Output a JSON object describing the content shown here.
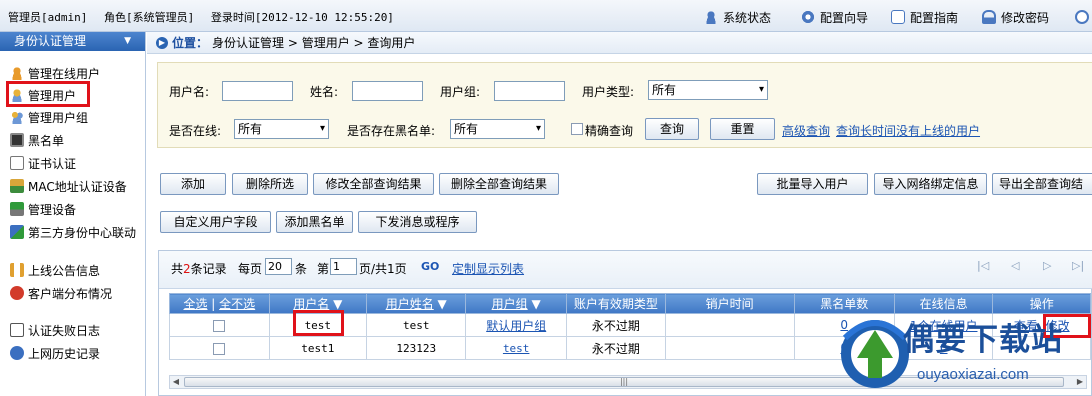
{
  "topbar": {
    "admin_text": "管理员[admin]",
    "role_text": "角色[系统管理员]",
    "login_text": "登录时间[2012-12-10 12:55:20]",
    "links": [
      {
        "label": "系统状态",
        "icon": "user-icon"
      },
      {
        "label": "配置向导",
        "icon": "gear-icon"
      },
      {
        "label": "配置指南",
        "icon": "document-icon"
      },
      {
        "label": "修改密码",
        "icon": "lock-icon"
      }
    ]
  },
  "sidebar": {
    "header": "身份认证管理",
    "items": [
      {
        "label": "管理在线用户",
        "icon": "user-online-icon"
      },
      {
        "label": "管理用户",
        "icon": "user-icon"
      },
      {
        "label": "管理用户组",
        "icon": "group-icon"
      },
      {
        "label": "黑名单",
        "icon": "blacklist-icon"
      },
      {
        "label": "证书认证",
        "icon": "certificate-icon"
      },
      {
        "label": "MAC地址认证设备",
        "icon": "mac-icon"
      },
      {
        "label": "管理设备",
        "icon": "device-icon"
      },
      {
        "label": "第三方身份中心联动",
        "icon": "link-icon"
      },
      {
        "label": "上线公告信息",
        "icon": "speaker-icon"
      },
      {
        "label": "客户端分布情况",
        "icon": "chart-icon"
      },
      {
        "label": "认证失败日志",
        "icon": "log-icon"
      },
      {
        "label": "上网历史记录",
        "icon": "history-icon"
      }
    ]
  },
  "breadcrumb": {
    "location_label": "位置：",
    "path": "身份认证管理 > 管理用户 > 查询用户"
  },
  "search": {
    "username_label": "用户名:",
    "name_label": "姓名:",
    "group_label": "用户组:",
    "type_label": "用户类型:",
    "type_value": "所有",
    "online_label": "是否在线:",
    "online_value": "所有",
    "blacklist_label": "是否存在黑名单:",
    "blacklist_value": "所有",
    "exact_label": "精确查询",
    "query_button": "查询",
    "reset_button": "重置",
    "advanced_link": "高级查询",
    "inactive_link": "查询长时间没有上线的用户"
  },
  "actions": {
    "add": "添加",
    "delete_selected": "删除所选",
    "modify_all": "修改全部查询结果",
    "delete_all": "删除全部查询结果",
    "batch_import": "批量导入用户",
    "import_binding": "导入网络绑定信息",
    "export_all": "导出全部查询结",
    "custom_field": "自定义用户字段",
    "add_blacklist": "添加黑名单",
    "send_message": "下发消息或程序"
  },
  "pager": {
    "total_prefix": "共",
    "total_count": "2",
    "total_suffix": "条记录",
    "per_page_label": "每页",
    "per_page_value": "20",
    "per_page_unit": "条",
    "page_label": "第",
    "page_value": "1",
    "page_suffix": "页/共1页",
    "go": "GO",
    "custom_columns": "定制显示列表"
  },
  "table": {
    "select_all": "全选",
    "select_none": "全不选",
    "columns": [
      "用户名",
      "用户姓名",
      "用户组",
      "账户有效期类型",
      "销户时间",
      "黑名单数",
      "在线信息",
      "操作"
    ],
    "rows": [
      {
        "username": "test",
        "fullname": "test",
        "group": "默认用户组",
        "validity": "永不过期",
        "close_time": "",
        "blacklist": "0",
        "online": "1个在线用户",
        "view": "查看",
        "edit": "修改"
      },
      {
        "username": "test1",
        "fullname": "123123",
        "group": "test",
        "validity": "永不过期",
        "close_time": "",
        "blacklist": "0",
        "online": "0",
        "view": "",
        "edit": ""
      }
    ]
  },
  "watermark": {
    "title": "偶要下载站",
    "url": "ouyaoxiazai.com"
  },
  "colors": {
    "accent": "#2a64b2",
    "highlight": "#e0121a",
    "link": "#1c55b3"
  }
}
